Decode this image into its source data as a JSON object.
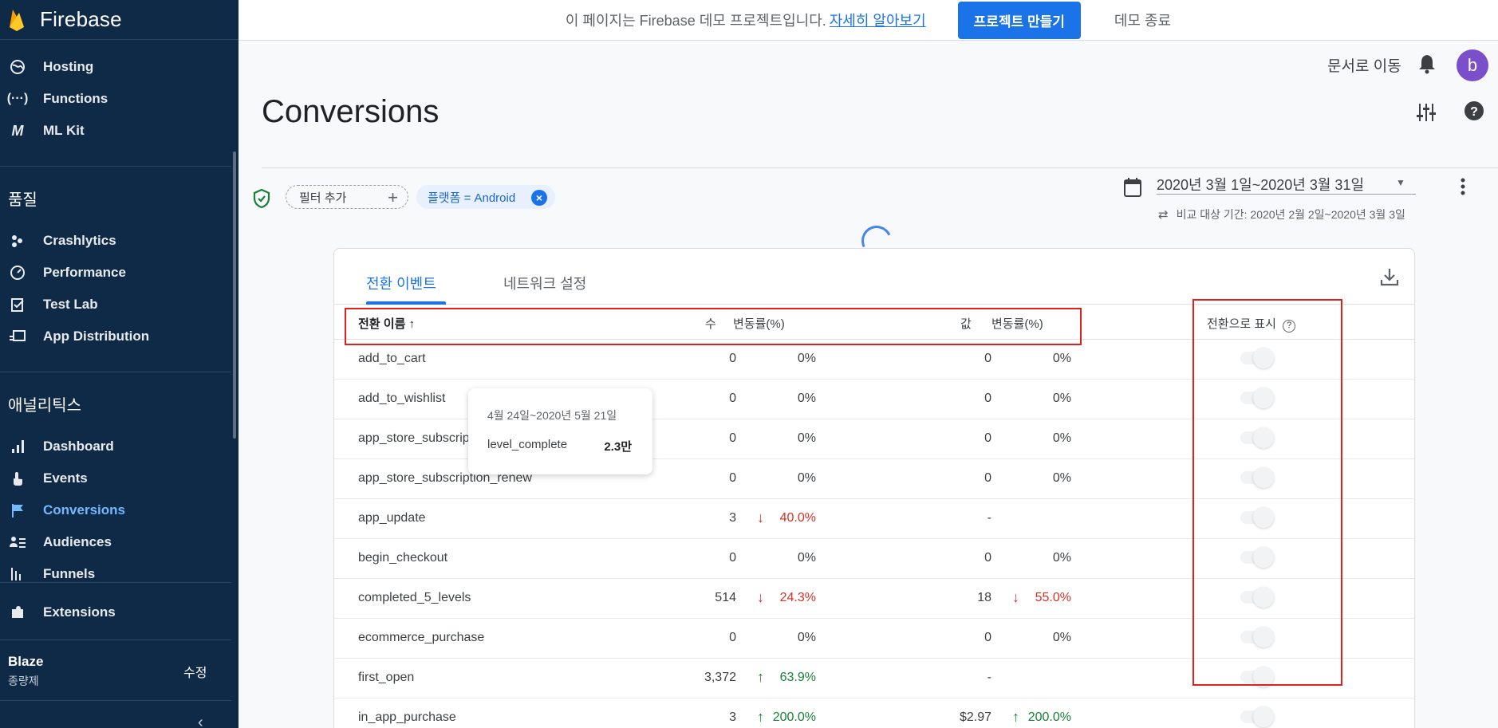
{
  "sidebar": {
    "brand": "Firebase",
    "items_top": [
      {
        "label": "Hosting",
        "icon": "globe-icon"
      },
      {
        "label": "Functions",
        "icon": "functions-icon"
      },
      {
        "label": "ML Kit",
        "icon": "ml-kit-icon"
      }
    ],
    "section_quality": "품질",
    "items_quality": [
      {
        "label": "Crashlytics",
        "icon": "crashlytics-icon"
      },
      {
        "label": "Performance",
        "icon": "performance-icon"
      },
      {
        "label": "Test Lab",
        "icon": "test-lab-icon"
      },
      {
        "label": "App Distribution",
        "icon": "app-distribution-icon"
      }
    ],
    "section_analytics": "애널리틱스",
    "items_analytics": [
      {
        "label": "Dashboard",
        "icon": "bar-chart-icon"
      },
      {
        "label": "Events",
        "icon": "touch-icon"
      },
      {
        "label": "Conversions",
        "icon": "flag-icon",
        "active": true
      },
      {
        "label": "Audiences",
        "icon": "audience-icon"
      },
      {
        "label": "Funnels",
        "icon": "funnel-icon"
      }
    ],
    "extensions": "Extensions",
    "plan_name": "Blaze",
    "plan_sub": "종량제",
    "plan_edit": "수정",
    "collapse_icon": "chevron-left-icon"
  },
  "banner": {
    "text": "이 페이지는 Firebase 데모 프로젝트입니다.",
    "link": "자세히 알아보기",
    "create_button": "프로젝트 만들기",
    "exit": "데모 종료"
  },
  "header": {
    "docs_link": "문서로 이동",
    "avatar_letter": "b",
    "title": "Conversions"
  },
  "filters": {
    "add_filter": "필터 추가",
    "platform_chip": "플랫폼 = Android"
  },
  "date": {
    "range": "2020년 3월 1일~2020년 3월 31일",
    "compare": "비교 대상 기간: 2020년 2월 2일~2020년 3월 3일"
  },
  "tabs": [
    "전환 이벤트",
    "네트워크 설정"
  ],
  "table": {
    "headers": {
      "name": "전환 이름",
      "count": "수",
      "count_change": "변동률(%)",
      "value": "값",
      "value_change": "변동률(%)",
      "mark_as_conversion": "전환으로 표시"
    },
    "rows": [
      {
        "name": "add_to_cart",
        "count": "0",
        "count_change": "0%",
        "count_dir": "",
        "value": "0",
        "value_change": "0%",
        "value_dir": ""
      },
      {
        "name": "add_to_wishlist",
        "count": "0",
        "count_change": "0%",
        "count_dir": "",
        "value": "0",
        "value_change": "0%",
        "value_dir": ""
      },
      {
        "name": "app_store_subscrip",
        "count": "0",
        "count_change": "0%",
        "count_dir": "",
        "value": "0",
        "value_change": "0%",
        "value_dir": ""
      },
      {
        "name": "app_store_subscription_renew",
        "count": "0",
        "count_change": "0%",
        "count_dir": "",
        "value": "0",
        "value_change": "0%",
        "value_dir": ""
      },
      {
        "name": "app_update",
        "count": "3",
        "count_change": "40.0%",
        "count_dir": "down",
        "value": "-",
        "value_change": "",
        "value_dir": ""
      },
      {
        "name": "begin_checkout",
        "count": "0",
        "count_change": "0%",
        "count_dir": "",
        "value": "0",
        "value_change": "0%",
        "value_dir": ""
      },
      {
        "name": "completed_5_levels",
        "count": "514",
        "count_change": "24.3%",
        "count_dir": "down",
        "value": "18",
        "value_change": "55.0%",
        "value_dir": "down"
      },
      {
        "name": "ecommerce_purchase",
        "count": "0",
        "count_change": "0%",
        "count_dir": "",
        "value": "0",
        "value_change": "0%",
        "value_dir": ""
      },
      {
        "name": "first_open",
        "count": "3,372",
        "count_change": "63.9%",
        "count_dir": "up",
        "value": "-",
        "value_change": "",
        "value_dir": ""
      },
      {
        "name": "in_app_purchase",
        "count": "3",
        "count_change": "200.0%",
        "count_dir": "up",
        "value": "$2.97",
        "value_change": "200.0%",
        "value_dir": "up"
      }
    ]
  },
  "tooltip": {
    "date": "4월 24일~2020년 5월 21일",
    "label": "level_complete",
    "value": "2.3만"
  },
  "colors": {
    "sidebar_bg": "#0f2a47",
    "accent": "#1a73e8",
    "down": "#d93025",
    "up": "#188038",
    "annotation": "#e0201a"
  }
}
